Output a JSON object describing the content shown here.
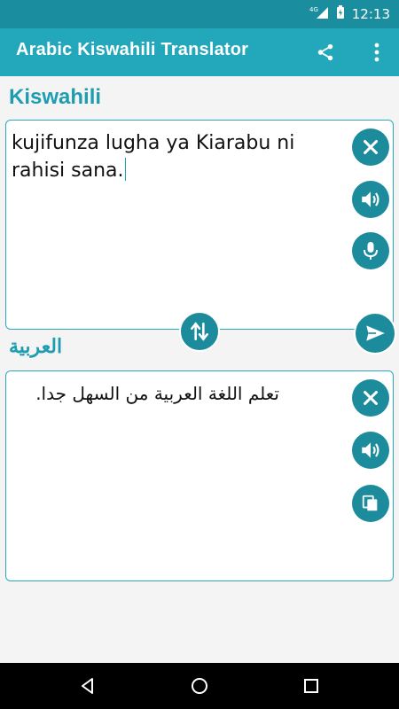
{
  "status_bar": {
    "time": "12:13",
    "network": "4G"
  },
  "app_bar": {
    "title": "Arabic Kiswahili Translator",
    "share_icon": "share-icon",
    "menu_icon": "more-vert-icon"
  },
  "source": {
    "language": "Kiswahili",
    "text": "kujifunza lugha ya Kiarabu ni rahisi sana.",
    "buttons": [
      "clear-icon",
      "speaker-icon",
      "mic-icon"
    ]
  },
  "target": {
    "language": "العربية",
    "text": "تعلم اللغة العربية من السهل جدا.",
    "buttons": [
      "clear-icon",
      "speaker-icon",
      "copy-icon"
    ]
  },
  "actions": {
    "swap_icon": "swap-vertical-icon",
    "translate_icon": "send-icon"
  },
  "colors": {
    "status_bar": "#1a8e9f",
    "app_bar": "#23a7ba",
    "accent": "#1e9db1",
    "button": "#1c8b9c"
  }
}
